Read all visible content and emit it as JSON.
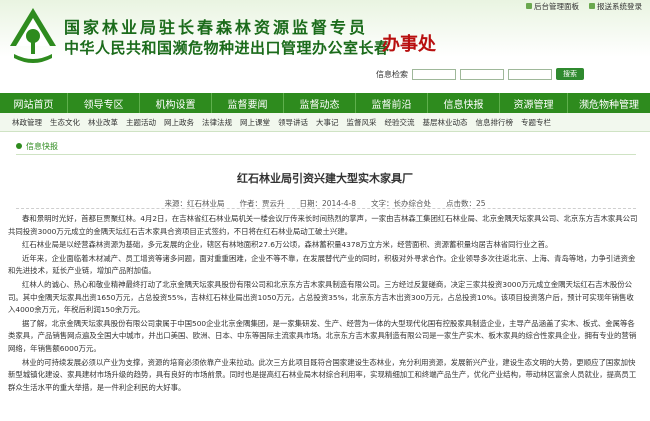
{
  "toplinks": {
    "admin": "后台管理面板",
    "cms": "报送系统登录"
  },
  "header": {
    "line1": "国家林业局驻长春森林资源监督专员",
    "line2": "中华人民共和国濒危物种进出口管理办公室长春",
    "line3": "办事处"
  },
  "search": {
    "label": "信息检索",
    "button": "搜索"
  },
  "nav": [
    {
      "label": "网站首页"
    },
    {
      "label": "领导专区"
    },
    {
      "label": "机构设置"
    },
    {
      "label": "监督要闻"
    },
    {
      "label": "监督动态"
    },
    {
      "label": "监督前沿"
    },
    {
      "label": "信息快报"
    },
    {
      "label": "资源管理"
    },
    {
      "label": "濒危物种管理"
    }
  ],
  "subnav": [
    "林政管理",
    "生态文化",
    "林业改革",
    "主题活动",
    "网上政务",
    "法律法规",
    "网上课堂",
    "领导讲话",
    "大事记",
    "监督风采",
    "经验交流",
    "基层林业动态",
    "信息排行榜",
    "专题专栏"
  ],
  "breadcrumb": "信息快报",
  "article": {
    "title": "红石林业局引资兴建大型实木家具厂",
    "meta": "来源：红石林业局　　作者：贾云升　　日期：2014-4-8　　文字：长办综合处　　点击数：25",
    "paragraphs": [
      "春和景明时光好，首都巨贾聚红林。4月2日，在吉林省红石林业局机关一楼会议厅传来长时间热烈的掌声，一家由吉林森工集团红石林业局、北京金隅天坛家具公司、北京东方吉木家具公司共同投资3000万元成立的金隅天坛红石吉木家具合资项目正式签约，不日将在红石林业局动工破土兴建。",
      "红石林业局是以经营森林资源为基础，多元发展的企业，辖区有林地面积27.6万公顷，森林蓄积量4378万立方米，经营面积、资源蓄积量均居吉林省同行业之首。",
      "近年来，企业面临着木材减产、员工增资等诸多问题，面对重重困难，企业不等不靠，在发展替代产业的同时，积极对外寻求合作。企业领导多次往返北京、上海、青岛等地，力争引进资金和先进技术，延长产业链，增加产品附加值。",
      "红林人的诚心、热心和敬业精神最终打动了北京金隅天坛家具股份有限公司和北京东方吉木家具制造有限公司。三方经过反复磋商，决定三家共投资3000万元成立金隅天坛红石吉木股份公司。其中金隅天坛家具出资1650万元，占总投资55%，吉林红石林业局出资1050万元，占总投资35%，北京东方吉木出资300万元，占总投资10%。该项目投资落户后，预计可实现年销售收入4000余万元，年税后利润150余万元。",
      "据了解，北京金隅天坛家具股份有限公司隶属于中国500企业北京金隅集团，是一家集研发、生产、经营为一体的大型现代化国有控股家具制造企业，主导产品涵盖了实木、板式、金属等各类家具，产品销售网点遍及全国大中城市，并出口美国、欧洲、日本、中东等国际主流家具市场。北京东方吉木家具制造有限公司是一家生产实木、板木家具的综合性家具企业，拥有专业的营销网络，年销售额6000万元。",
      "林业的可持续发展必须以产业为支撑，资源的培育必须依靠产业来拉动。此次三方此项目既符合国家建设生态林业，充分利用资源，发展新兴产业，建设生态文明的大势，更顺应了国家加快新型城镇化建设、家具建材市场升级的趋势，具有良好的市场前景。同时也是提高红石林业局木材综合利用率，实现精细加工和终端产品生产，优化产业结构，带动林区富余人员就业，提高员工群众生活水平的重大举措，是一件利企利民的大好事。"
    ]
  },
  "colors": {
    "nav_green": "#2e8b1e",
    "title_green": "#1b6b1b",
    "title_red": "#b80f0f"
  }
}
